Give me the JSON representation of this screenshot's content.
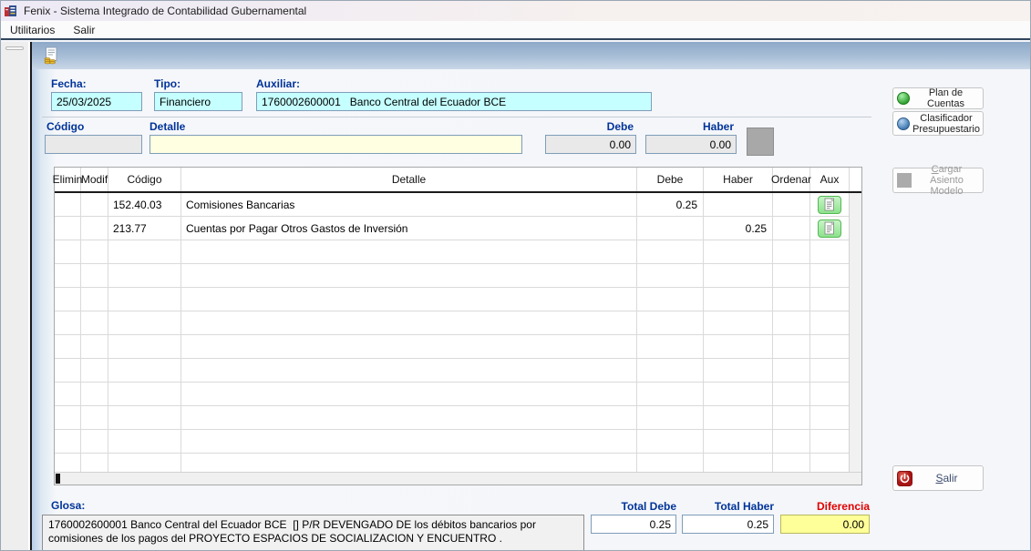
{
  "window": {
    "title": "Fenix - Sistema Integrado de Contabilidad Gubernamental"
  },
  "menu": {
    "items": {
      "utilitarios": "Utilitarios",
      "salir": "Salir"
    }
  },
  "toolbar": {
    "icons": [
      "journal-entry-document-icon"
    ]
  },
  "form": {
    "fecha_label": "Fecha:",
    "fecha_value": "25/03/2025",
    "tipo_label": "Tipo:",
    "tipo_value": "Financiero",
    "auxiliar_label": "Auxiliar:",
    "auxiliar_value": "1760002600001   Banco Central del Ecuador BCE"
  },
  "entry_row": {
    "codigo_label": "Código",
    "codigo_value": "",
    "detalle_label": "Detalle",
    "detalle_value": "",
    "debe_label": "Debe",
    "debe_value": "0.00",
    "haber_label": "Haber",
    "haber_value": "0.00"
  },
  "table": {
    "columns": [
      "Elimin",
      "Modif",
      "Código",
      "Detalle",
      "Debe",
      "Haber",
      "Ordenar",
      "Aux"
    ],
    "rows": [
      {
        "elimin": "",
        "modif": "",
        "codigo": "152.40.03",
        "detalle": "Comisiones Bancarias",
        "debe": "0.25",
        "haber": "",
        "ordenar": "",
        "aux_button": true
      },
      {
        "elimin": "",
        "modif": "",
        "codigo": "213.77",
        "detalle": "Cuentas por Pagar Otros Gastos de Inversión",
        "debe": "",
        "haber": "0.25",
        "ordenar": "",
        "aux_button": true
      }
    ],
    "empty_rows": 10
  },
  "side_panel": {
    "plan_de_cuentas_label": "Plan de Cuentas",
    "clasificador_label": "Clasificador Presupuestario",
    "cargar_asiento_label": "Cargar Asiento Modelo",
    "salir_label": "Salir"
  },
  "footer": {
    "glosa_label": "Glosa:",
    "glosa_value": "1760002600001 Banco Central del Ecuador BCE  [] P/R DEVENGADO DE los débitos bancarios por comisiones de los pagos del PROYECTO ESPACIOS DE SOCIALIZACION Y ENCUENTRO .",
    "total_debe_label": "Total Debe",
    "total_debe_value": "0.25",
    "total_haber_label": "Total Haber",
    "total_haber_value": "0.25",
    "diferencia_label": "Diferencia",
    "diferencia_value": "0.00"
  },
  "colors": {
    "field_cyan": "#C5FFFF",
    "field_yellow": "#FFFFE1",
    "field_disabled_gray": "#E9E9E9",
    "diferencia_yellow": "#FFFF99",
    "label_navy": "#003399",
    "diferencia_red": "#E00000",
    "aux_button_green": "#8CE28C",
    "toolbar_blue": "#8EA9C8"
  }
}
